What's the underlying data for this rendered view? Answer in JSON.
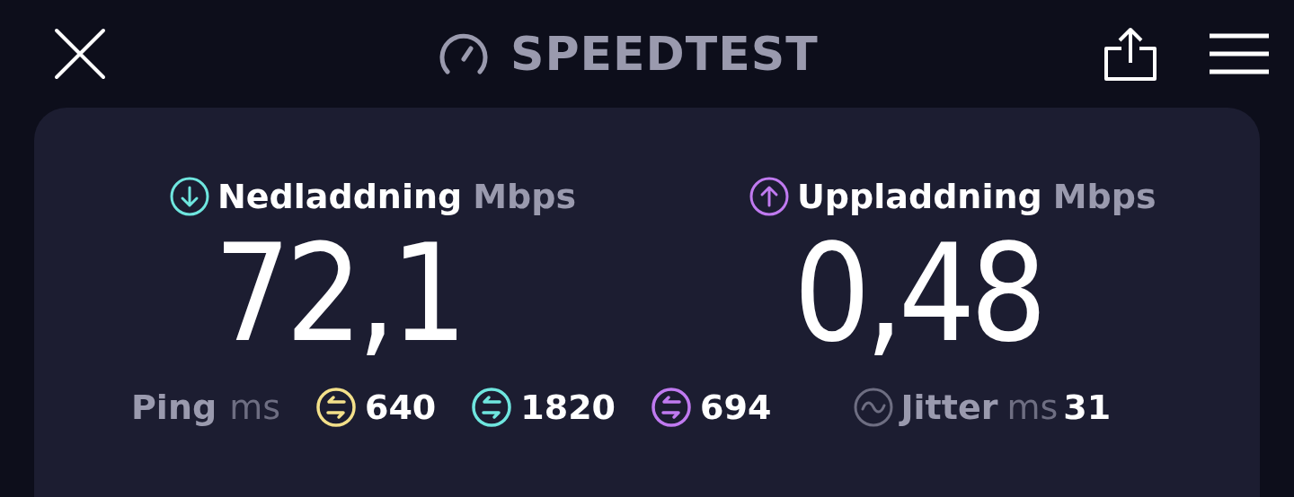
{
  "header": {
    "title": "SPEEDTEST"
  },
  "results": [
    {
      "kind": "download",
      "label": "Nedladdning",
      "unit": "Mbps",
      "value": "72,1"
    },
    {
      "kind": "upload",
      "label": "Uppladdning",
      "unit": "Mbps",
      "value": "0,48"
    }
  ],
  "ping": {
    "label": "Ping",
    "unit": "ms",
    "values": [
      {
        "value": "640",
        "color": "#f3e08a"
      },
      {
        "value": "1820",
        "color": "#6fe6df"
      },
      {
        "value": "694",
        "color": "#c07af0"
      }
    ]
  },
  "jitter": {
    "label": "Jitter",
    "unit": "ms",
    "value": "31"
  }
}
